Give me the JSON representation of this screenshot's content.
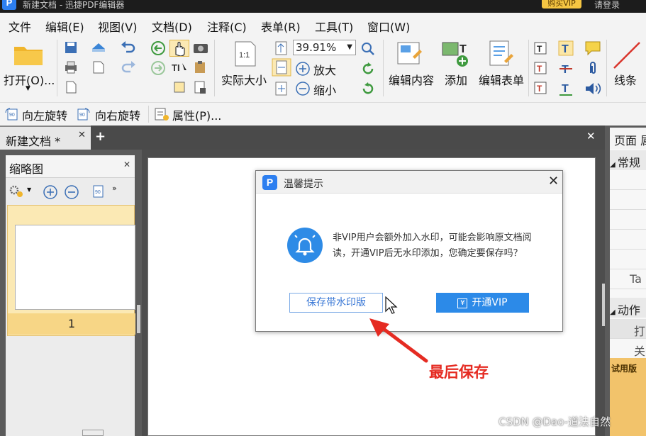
{
  "window": {
    "title": "新建文档 - 迅捷PDF编辑器",
    "vip_button": "购买VIP",
    "login": "请登录"
  },
  "menu": [
    "文件",
    "编辑(E)",
    "视图(V)",
    "文档(D)",
    "注释(C)",
    "表单(R)",
    "工具(T)",
    "窗口(W)"
  ],
  "ribbon": {
    "open": "打开(O)...",
    "actual_size": "实际大小",
    "zoom_value": "39.91%",
    "zoom_in": "放大",
    "zoom_out": "缩小",
    "edit_content": "编辑内容",
    "add": "添加",
    "edit_form": "编辑表单",
    "line": "线条"
  },
  "quickbar": {
    "rotate_left": "向左旋转",
    "rotate_right": "向右旋转",
    "properties": "属性(P)..."
  },
  "tabs": {
    "doc_tab": "新建文档 *"
  },
  "thumbnails": {
    "title": "缩略图",
    "page_number": "1"
  },
  "properties_panel": {
    "title": "页面 属性",
    "section_general": "常规",
    "row_ta": "Ta",
    "section_action": "动作",
    "row_1": "打",
    "row_2": "关",
    "trial": "试用版"
  },
  "dialog": {
    "title": "温馨提示",
    "message_line1": "非VIP用户会额外加入水印，可能会影响原文档阅",
    "message_line2": "读，开通VIP后无水印添加，您确定要保存吗？",
    "save_watermark": "保存带水印版",
    "open_vip": "开通VIP"
  },
  "annotation": "最后保存",
  "watermark": "CSDN @Dao-道法自然",
  "colors": {
    "accent_blue": "#2c8ae8",
    "annotation_red": "#e52b22",
    "selection_yellow": "#f7d686"
  }
}
